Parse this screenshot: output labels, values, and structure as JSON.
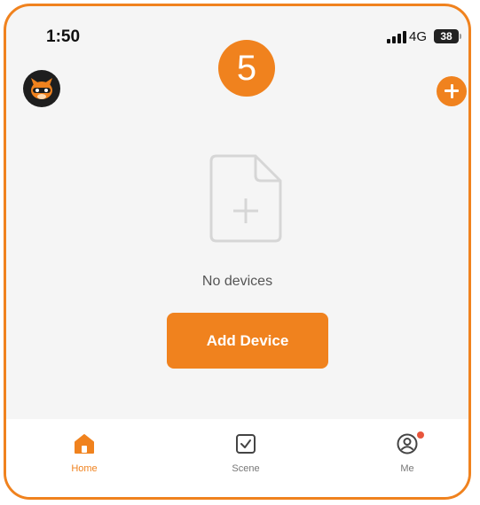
{
  "status_bar": {
    "time": "1:50",
    "network": "4G",
    "battery": "38",
    "signal_icon": "signal-bars-icon"
  },
  "overlay": {
    "step_number": "5"
  },
  "header": {
    "avatar_icon": "cat-avatar-icon",
    "add_icon": "plus-circle-icon"
  },
  "main": {
    "empty_icon": "add-document-icon",
    "empty_text": "No devices",
    "add_device_label": "Add Device"
  },
  "tabs": [
    {
      "label": "Home",
      "icon": "home-icon",
      "active": true
    },
    {
      "label": "Scene",
      "icon": "scene-checkbox-icon",
      "active": false
    },
    {
      "label": "Me",
      "icon": "profile-icon",
      "active": false,
      "has_notification": true
    }
  ],
  "colors": {
    "accent": "#f0821e",
    "background": "#f5f5f5",
    "tab_bar": "#ffffff",
    "notification": "#e8553c"
  }
}
